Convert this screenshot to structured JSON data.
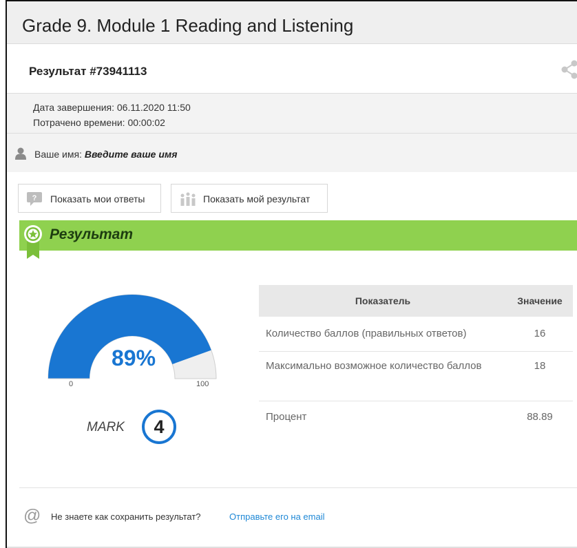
{
  "page": {
    "title": "Grade 9. Module 1 Reading and Listening"
  },
  "result": {
    "id_label": "Результат #73941113",
    "completion_date": "Дата завершения: 06.11.2020 11:50",
    "time_spent": "Потрачено времени: 00:00:02",
    "name_label": "Ваше имя:",
    "name_placeholder": "Введите ваше имя"
  },
  "buttons": {
    "show_answers": "Показать мои ответы",
    "show_result": "Показать мой результат"
  },
  "banner": {
    "title": "Результат",
    "color": "#8fd14f"
  },
  "gauge": {
    "percent_label": "89%",
    "value": 89,
    "min_label": "0",
    "max_label": "100",
    "fill_color": "#1976d2"
  },
  "mark": {
    "label": "MARK",
    "value": "4"
  },
  "table": {
    "headers": [
      "Показатель",
      "Значение"
    ],
    "rows": [
      {
        "name": "Количество баллов (правильных ответов)",
        "value": "16"
      },
      {
        "name": "Максимально возможное количество баллов",
        "value": "18"
      },
      {
        "name": "Процент",
        "value": "88.89"
      }
    ]
  },
  "footer": {
    "question": "Не знаете как сохранить результат?",
    "link": "Отправьте его на email"
  },
  "icons": {
    "share": "share-icon",
    "user": "user-icon",
    "question": "question-icon",
    "chart": "chart-icon",
    "badge": "award-badge-icon",
    "at": "at-icon"
  }
}
